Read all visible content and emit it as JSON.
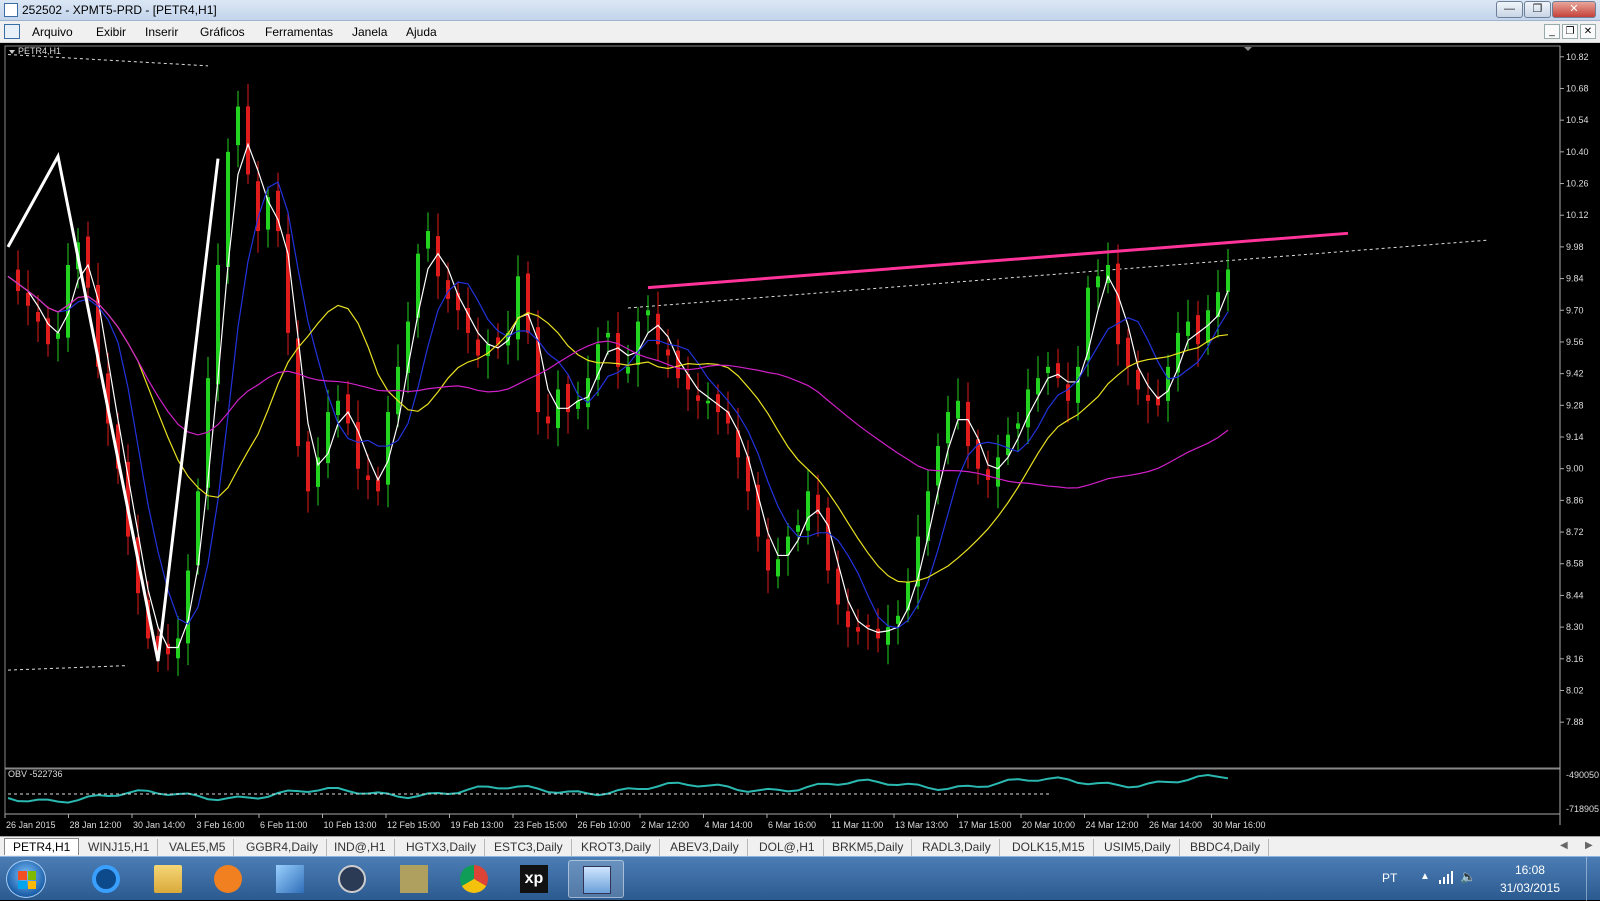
{
  "window": {
    "title": "252502 - XPMT5-PRD - [PETR4,H1]"
  },
  "menu": [
    "Arquivo",
    "Exibir",
    "Inserir",
    "Gráficos",
    "Ferramentas",
    "Janela",
    "Ajuda"
  ],
  "chart": {
    "label": "PETR4,H1",
    "obv_label": "OBV -522736",
    "obv_ticks": [
      "-490050",
      "-718905"
    ],
    "price_ticks": [
      "10.82",
      "10.68",
      "10.54",
      "10.40",
      "10.26",
      "10.12",
      "9.98",
      "9.84",
      "9.70",
      "9.56",
      "9.42",
      "9.28",
      "9.14",
      "9.00",
      "8.86",
      "8.72",
      "8.58",
      "8.44",
      "8.30",
      "8.16",
      "8.02",
      "7.88"
    ],
    "date_ticks": [
      "26 Jan 2015",
      "28 Jan 12:00",
      "30 Jan 14:00",
      "3 Feb 16:00",
      "6 Feb 11:00",
      "10 Feb 13:00",
      "12 Feb 15:00",
      "19 Feb 13:00",
      "23 Feb 15:00",
      "26 Feb 10:00",
      "2 Mar 12:00",
      "4 Mar 14:00",
      "6 Mar 16:00",
      "11 Mar 11:00",
      "13 Mar 13:00",
      "17 Mar 15:00",
      "20 Mar 10:00",
      "24 Mar 12:00",
      "26 Mar 14:00",
      "30 Mar 16:00"
    ],
    "colors": {
      "bull": "#22d41f",
      "bear": "#e01b1b",
      "ma_white": "#ffffff",
      "ma_blue": "#2233dd",
      "ma_yellow": "#e8e020",
      "ma_magenta": "#d020c8",
      "resistance": "#ff3399",
      "obv": "#2ab8b0"
    }
  },
  "chart_data": {
    "type": "candlestick",
    "symbol": "PETR4",
    "timeframe": "H1",
    "ylim": [
      7.81,
      10.85
    ],
    "anchors_price": [
      [
        0,
        9.85
      ],
      [
        2,
        9.72
      ],
      [
        3,
        9.65
      ],
      [
        4,
        9.55
      ],
      [
        5,
        9.6
      ],
      [
        6,
        9.9
      ],
      [
        7,
        10.0
      ],
      [
        8,
        9.8
      ],
      [
        9,
        9.45
      ],
      [
        10,
        9.2
      ],
      [
        11,
        9.0
      ],
      [
        12,
        8.7
      ],
      [
        13,
        8.45
      ],
      [
        14,
        8.25
      ],
      [
        15,
        8.2
      ],
      [
        16,
        8.18
      ],
      [
        17,
        8.25
      ],
      [
        18,
        8.55
      ],
      [
        19,
        8.9
      ],
      [
        20,
        9.4
      ],
      [
        21,
        9.9
      ],
      [
        22,
        10.4
      ],
      [
        23,
        10.6
      ],
      [
        24,
        10.3
      ],
      [
        25,
        10.05
      ],
      [
        26,
        10.2
      ],
      [
        27,
        10.05
      ],
      [
        28,
        9.6
      ],
      [
        29,
        9.1
      ],
      [
        30,
        8.9
      ],
      [
        31,
        9.05
      ],
      [
        32,
        9.25
      ],
      [
        33,
        9.3
      ],
      [
        34,
        9.2
      ],
      [
        35,
        9.0
      ],
      [
        36,
        8.95
      ],
      [
        37,
        8.9
      ],
      [
        38,
        9.25
      ],
      [
        39,
        9.45
      ],
      [
        40,
        9.65
      ],
      [
        41,
        9.95
      ],
      [
        42,
        10.05
      ],
      [
        43,
        9.85
      ],
      [
        44,
        9.75
      ],
      [
        45,
        9.7
      ],
      [
        46,
        9.6
      ],
      [
        47,
        9.5
      ],
      [
        48,
        9.55
      ],
      [
        49,
        9.55
      ],
      [
        50,
        9.6
      ],
      [
        51,
        9.85
      ],
      [
        52,
        9.6
      ],
      [
        53,
        9.25
      ],
      [
        54,
        9.2
      ],
      [
        55,
        9.35
      ],
      [
        56,
        9.25
      ],
      [
        57,
        9.3
      ],
      [
        58,
        9.4
      ],
      [
        59,
        9.55
      ],
      [
        60,
        9.6
      ],
      [
        61,
        9.45
      ],
      [
        62,
        9.45
      ],
      [
        63,
        9.65
      ],
      [
        64,
        9.7
      ],
      [
        65,
        9.55
      ],
      [
        66,
        9.5
      ],
      [
        67,
        9.4
      ],
      [
        68,
        9.35
      ],
      [
        69,
        9.3
      ],
      [
        70,
        9.3
      ],
      [
        71,
        9.25
      ],
      [
        72,
        9.2
      ],
      [
        73,
        9.05
      ],
      [
        74,
        8.9
      ],
      [
        75,
        8.7
      ],
      [
        76,
        8.55
      ],
      [
        77,
        8.6
      ],
      [
        78,
        8.7
      ],
      [
        79,
        8.75
      ],
      [
        80,
        8.9
      ],
      [
        81,
        8.8
      ],
      [
        82,
        8.55
      ],
      [
        83,
        8.4
      ],
      [
        84,
        8.3
      ],
      [
        85,
        8.28
      ],
      [
        86,
        8.3
      ],
      [
        87,
        8.25
      ],
      [
        88,
        8.3
      ],
      [
        89,
        8.35
      ],
      [
        90,
        8.5
      ],
      [
        91,
        8.7
      ],
      [
        92,
        8.9
      ],
      [
        93,
        9.1
      ],
      [
        94,
        9.25
      ],
      [
        95,
        9.3
      ],
      [
        96,
        9.1
      ],
      [
        97,
        9.0
      ],
      [
        98,
        8.95
      ],
      [
        99,
        9.05
      ],
      [
        100,
        9.15
      ],
      [
        101,
        9.2
      ],
      [
        102,
        9.35
      ],
      [
        103,
        9.4
      ],
      [
        104,
        9.45
      ],
      [
        105,
        9.4
      ],
      [
        106,
        9.3
      ],
      [
        107,
        9.45
      ],
      [
        108,
        9.8
      ],
      [
        109,
        9.85
      ],
      [
        110,
        9.9
      ],
      [
        111,
        9.55
      ],
      [
        112,
        9.45
      ],
      [
        113,
        9.35
      ],
      [
        114,
        9.3
      ],
      [
        115,
        9.28
      ],
      [
        116,
        9.45
      ],
      [
        117,
        9.6
      ],
      [
        118,
        9.65
      ],
      [
        119,
        9.55
      ],
      [
        120,
        9.7
      ],
      [
        121,
        9.78
      ],
      [
        122,
        9.88
      ]
    ],
    "zigzag_price": [
      [
        0,
        9.98
      ],
      [
        5,
        10.38
      ],
      [
        15,
        8.15
      ],
      [
        21,
        10.37
      ]
    ],
    "resistance_line_price": [
      [
        64,
        9.8
      ],
      [
        134,
        10.04
      ]
    ],
    "trend_dotted_price": [
      [
        62,
        9.71
      ],
      [
        148,
        10.01
      ]
    ],
    "left_dotted_upper_price": [
      [
        0,
        10.83
      ],
      [
        20,
        10.78
      ]
    ],
    "left_dotted_lower_price": [
      [
        0,
        8.11
      ],
      [
        12,
        8.13
      ]
    ]
  }
}
